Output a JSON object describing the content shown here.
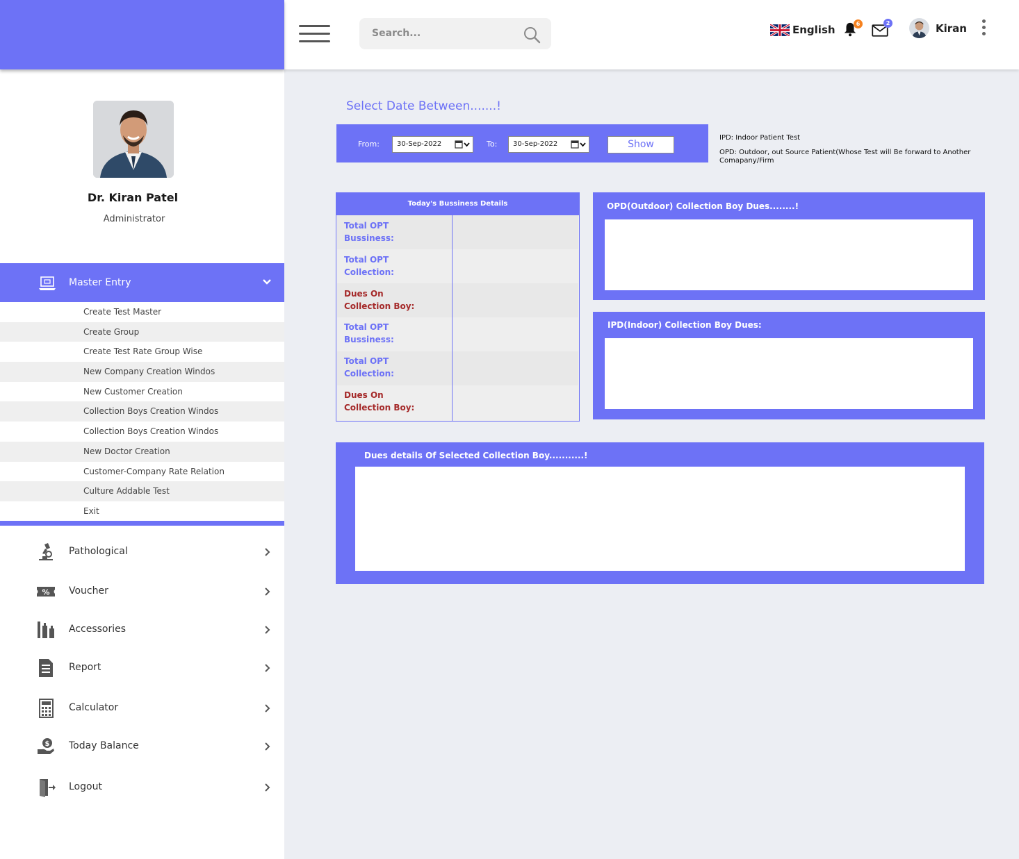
{
  "header": {
    "search_placeholder": "Search...",
    "language": "English",
    "notifications_count": "6",
    "messages_count": "2",
    "user_name": "Kiran"
  },
  "profile": {
    "name": "Dr. Kiran Patel",
    "role": "Administrator"
  },
  "sidebar": {
    "master_entry": {
      "label": "Master Entry",
      "items": [
        "Create Test Master",
        "Create Group",
        "Create Test Rate Group Wise",
        "New Company Creation Windos",
        "New Customer Creation",
        "Collection Boys Creation Windos",
        "Collection Boys Creation Windos",
        "New Doctor Creation",
        "Customer-Company Rate Relation",
        "Culture Addable Test",
        "Exit"
      ]
    },
    "nav": [
      {
        "label": "Pathological",
        "icon": "microscope-icon"
      },
      {
        "label": "Voucher",
        "icon": "voucher-icon"
      },
      {
        "label": "Accessories",
        "icon": "lab-bottles-icon"
      },
      {
        "label": "Report",
        "icon": "report-document-icon"
      },
      {
        "label": "Calculator",
        "icon": "calculator-icon"
      },
      {
        "label": "Today Balance",
        "icon": "balance-hand-icon"
      },
      {
        "label": "Logout",
        "icon": "logout-door-icon"
      }
    ]
  },
  "date_filter": {
    "title": "Select Date Between.......!",
    "from_label": "From:",
    "from_value": "30-Sep-2022",
    "to_label": "To:",
    "to_value": "30-Sep-2022",
    "show_label": "Show"
  },
  "legend": {
    "ipd": "IPD: Indoor Patient Test",
    "opd": "OPD: Outdoor, out Source Patient(Whose Test will Be forward to Another Comapany/Firm"
  },
  "business": {
    "title": "Today's Bussiness Details",
    "rows": [
      {
        "label_1": "Total OPT",
        "label_2": "Bussiness:",
        "value": ""
      },
      {
        "label_1": "Total OPT",
        "label_2": "Collection:",
        "value": ""
      },
      {
        "label_1": "Dues On",
        "label_2": "Collection Boy:",
        "value": ""
      },
      {
        "label_1": "Total OPT",
        "label_2": "Bussiness:",
        "value": ""
      },
      {
        "label_1": "Total OPT",
        "label_2": "Collection:",
        "value": ""
      },
      {
        "label_1": "Dues On",
        "label_2": "Collection Boy:",
        "value": ""
      }
    ]
  },
  "panels": {
    "opd_title": "OPD(Outdoor) Collection Boy Dues........!",
    "ipd_title": "IPD(Indoor) Collection Boy Dues:",
    "selected_title": "Dues details Of Selected Collection Boy...........!"
  },
  "colors": {
    "accent": "#6d72f6",
    "dues_label": "#a52a2a",
    "notification_badge": "#f6821f"
  }
}
